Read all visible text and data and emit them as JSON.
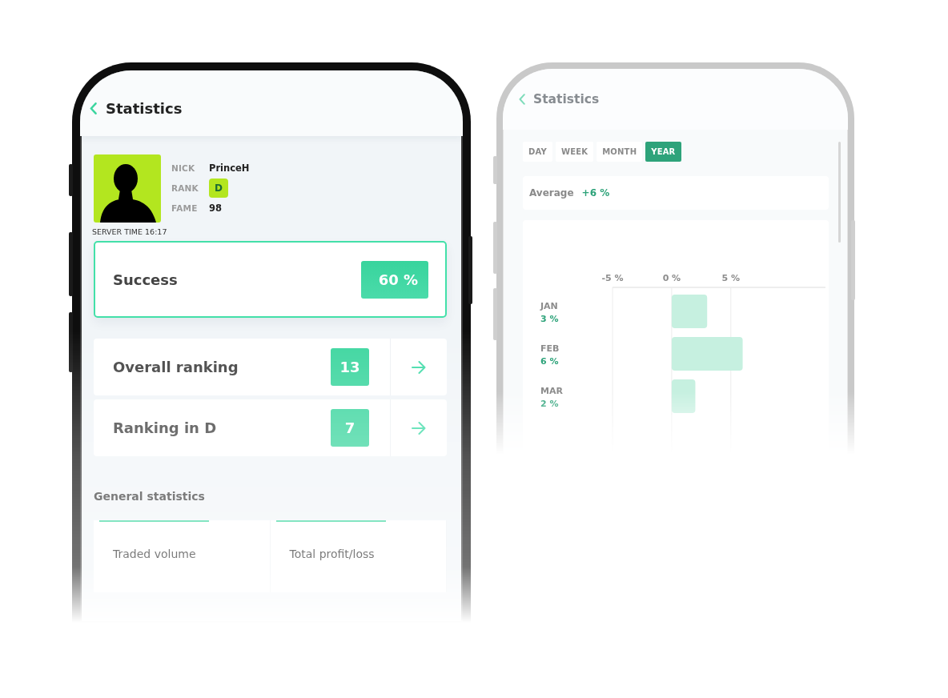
{
  "profile_screen": {
    "title": "Statistics",
    "profile": {
      "fields": [
        {
          "label": "NICK",
          "value": "PrinceH",
          "kind": "text"
        },
        {
          "label": "RANK",
          "value": "D",
          "kind": "badge"
        },
        {
          "label": "FAME",
          "value": "98",
          "kind": "text"
        }
      ],
      "server_time": "SERVER TIME 16:17"
    },
    "success": {
      "label": "Success",
      "value": "60 %"
    },
    "rankings": [
      {
        "label": "Overall ranking",
        "value": "13"
      },
      {
        "label": "Ranking in D",
        "value": "7"
      }
    ],
    "general_statistics": {
      "title": "General statistics",
      "cards": [
        {
          "label": "Traded volume"
        },
        {
          "label": "Total profit/loss"
        }
      ]
    }
  },
  "chart_screen": {
    "title": "Statistics",
    "periods": [
      {
        "label": "DAY",
        "selected": false
      },
      {
        "label": "WEEK",
        "selected": false
      },
      {
        "label": "MONTH",
        "selected": false
      },
      {
        "label": "YEAR",
        "selected": true
      }
    ],
    "average": {
      "label": "Average",
      "value": "+6 %"
    },
    "chart_data": {
      "type": "bar",
      "orientation": "horizontal",
      "categories": [
        "JAN",
        "FEB",
        "MAR"
      ],
      "values": [
        3,
        6,
        2
      ],
      "xlim": [
        -5,
        13
      ],
      "xticks": [
        {
          "value": -5,
          "label": "-5 %"
        },
        {
          "value": 0,
          "label": "0 %"
        },
        {
          "value": 5,
          "label": "5 %"
        }
      ],
      "value_labels": [
        "3 %",
        "6 %",
        "2 %"
      ]
    }
  }
}
